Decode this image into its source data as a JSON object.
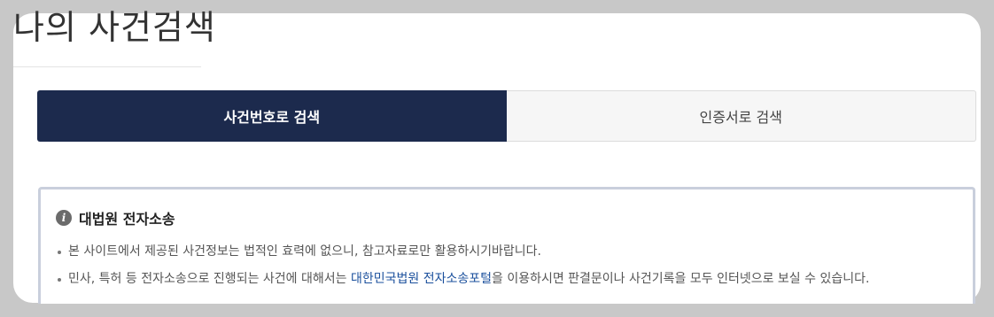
{
  "page": {
    "title": "나의 사건검색"
  },
  "tabs": [
    {
      "label": "사건번호로 검색",
      "active": true
    },
    {
      "label": "인증서로 검색",
      "active": false
    }
  ],
  "notice": {
    "icon": "info-icon",
    "title": "대법원 전자소송",
    "items": [
      {
        "text": "본 사이트에서 제공된 사건정보는 법적인 효력에 없으니, 참고자료로만 활용하시기바랍니다."
      },
      {
        "text_before": "민사, 특허 등 전자소송으로 진행되는 사건에 대해서는 ",
        "link_text": "대한민국법원 전자소송포털",
        "text_after": "을 이용하시면 판결문이나 사건기록을 모두 인터넷으로 보실 수 있습니다."
      }
    ]
  },
  "colors": {
    "active_tab": "#1c2a4d",
    "link": "#1a4f9c",
    "notice_border": "#c9cfdc"
  }
}
